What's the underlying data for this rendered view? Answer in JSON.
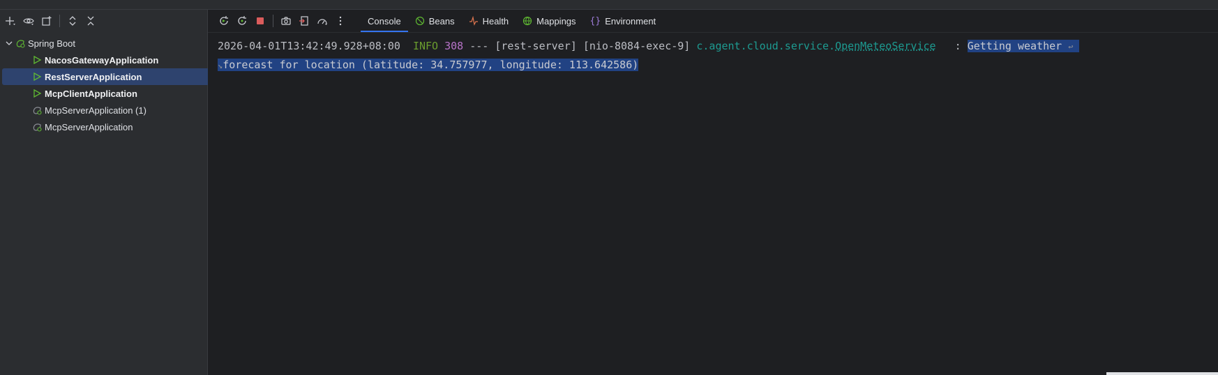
{
  "services_tree": {
    "group_label": "Spring Boot",
    "items": [
      {
        "label": "NacosGatewayApplication",
        "state": "running"
      },
      {
        "label": "RestServerApplication",
        "state": "running"
      },
      {
        "label": "McpClientApplication",
        "state": "running"
      },
      {
        "label": "McpServerApplication (1)",
        "state": "stopped"
      },
      {
        "label": "McpServerApplication",
        "state": "stopped"
      }
    ]
  },
  "tabs": {
    "console": "Console",
    "beans": "Beans",
    "health": "Health",
    "mappings": "Mappings",
    "environment": "Environment"
  },
  "log": {
    "timestamp": "2026-04-01T13:42:49.928+08:00",
    "level": "INFO",
    "pid": "308",
    "sep": "---",
    "app": "[rest-server]",
    "thread": "[nio-8084-exec-9]",
    "logger_pkg": "c.agent.cloud.service.",
    "logger_class": "OpenMeteoService",
    "colon": ":",
    "msg_line1": "Getting weather",
    "msg_line2": "forecast for location (latitude: 34.757977, longitude: 113.642586)"
  },
  "colors": {
    "accent": "#3574f0",
    "selection": "#214283",
    "info": "#6a9d2e",
    "pid": "#b874c9",
    "logger": "#1d9b91",
    "run_green": "#5fb832"
  }
}
